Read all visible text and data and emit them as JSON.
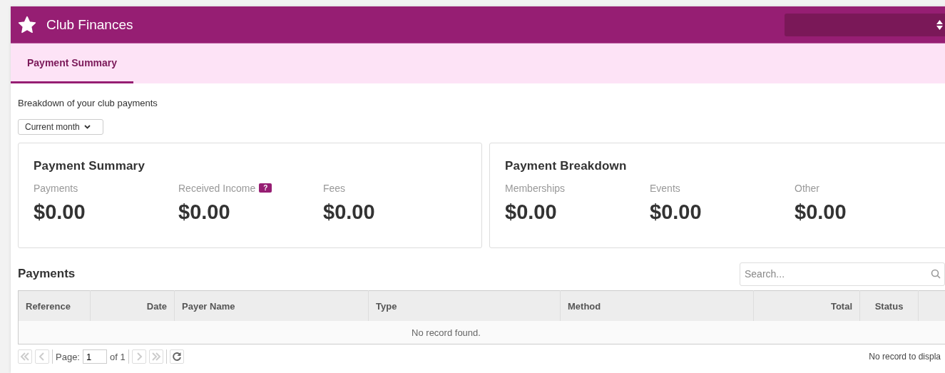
{
  "header": {
    "title": "Club Finances"
  },
  "tabs": [
    {
      "label": "Payment Summary",
      "selected": true
    }
  ],
  "intro": "Breakdown of your club payments",
  "period": {
    "value": "Current month"
  },
  "cards": [
    {
      "title": "Payment Summary",
      "stats": [
        {
          "label": "Payments",
          "value": "$0.00"
        },
        {
          "label": "Received Income",
          "value": "$0.00",
          "help_text": "?"
        },
        {
          "label": "Fees",
          "value": "$0.00"
        }
      ]
    },
    {
      "title": "Payment Breakdown",
      "stats": [
        {
          "label": "Memberships",
          "value": "$0.00"
        },
        {
          "label": "Events",
          "value": "$0.00"
        },
        {
          "label": "Other",
          "value": "$0.00"
        }
      ]
    }
  ],
  "payments": {
    "title": "Payments",
    "search": {
      "placeholder": "Search..."
    },
    "columns": [
      {
        "label": "Reference"
      },
      {
        "label": "Date"
      },
      {
        "label": "Payer Name"
      },
      {
        "label": "Type"
      },
      {
        "label": "Method"
      },
      {
        "label": "Total"
      },
      {
        "label": "Status"
      }
    ],
    "empty": "No record found."
  },
  "pager": {
    "page_label": "Page:",
    "page": "1",
    "of": "of 1",
    "buttons": [
      {
        "kind": "first",
        "disabled": true
      },
      {
        "kind": "prev",
        "disabled": true
      },
      {
        "kind": "next",
        "disabled": true
      },
      {
        "kind": "last",
        "disabled": true
      },
      {
        "kind": "refresh",
        "disabled": false
      }
    ],
    "status": "No record to displa"
  }
}
